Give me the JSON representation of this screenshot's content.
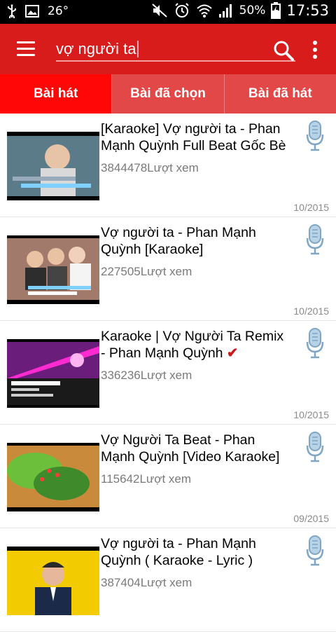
{
  "status_bar": {
    "temperature": "26°",
    "battery": "50%",
    "time": "17:53"
  },
  "toolbar": {
    "search_value": "vợ người ta"
  },
  "tabs": [
    {
      "label": "Bài hát"
    },
    {
      "label": "Bài đã chọn"
    },
    {
      "label": "Bài đã hát"
    }
  ],
  "songs": [
    {
      "title": "[Karaoke] Vợ người ta - Phan Mạnh Quỳnh Full Beat Gốc Bè",
      "views": "3844478Lượt xem",
      "date": "10/2015",
      "thumb_color": "#4c6f7f"
    },
    {
      "title": "Vợ người ta - Phan Mạnh Quỳnh [Karaoke]",
      "views": "227505Lượt xem",
      "date": "10/2015",
      "thumb_color": "#8c6a5a"
    },
    {
      "title": "Karaoke | Vợ Người Ta Remix - Phan Mạnh Quỳnh",
      "views": "336236Lượt xem",
      "date": "10/2015",
      "thumb_color": "#6a1d7a"
    },
    {
      "title": "Vợ Người Ta Beat - Phan Mạnh Quỳnh [Video Karaoke]",
      "views": "115642Lượt xem",
      "date": "09/2015",
      "thumb_color": "#3c6a2c"
    },
    {
      "title": "Vợ người ta - Phan Mạnh Quỳnh ( Karaoke - Lyric )",
      "views": "387404Lượt xem",
      "date": "",
      "thumb_color": "#f2cc00"
    }
  ],
  "colors": {
    "toolbar": "#d81b1b",
    "tab_active": "#ff0707",
    "tab_inactive": "#e34848",
    "mic": "#7fa6c4"
  }
}
